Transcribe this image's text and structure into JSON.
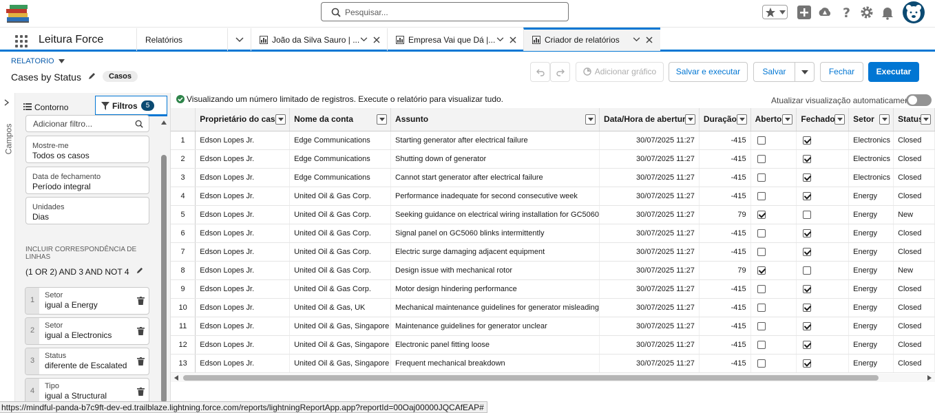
{
  "global": {
    "search_placeholder": "Pesquisar..."
  },
  "nav": {
    "app_name": "Leitura Force",
    "tabs": [
      {
        "label": "Relatórios"
      },
      {
        "label": "João da Silva Sauro | ..."
      },
      {
        "label": "Empresa Vai que Dá |..."
      },
      {
        "label": "Criador de relatórios"
      }
    ]
  },
  "header": {
    "report_label": "RELATORIO",
    "title": "Cases by Status",
    "type_pill": "Casos",
    "btn_add_chart": "Adicionar gráfico",
    "btn_save_run": "Salvar e executar",
    "btn_save": "Salvar",
    "btn_close": "Fechar",
    "btn_run": "Executar"
  },
  "rail": {
    "label": "Campos"
  },
  "panel": {
    "tab_outline": "Contorno",
    "tab_filters": "Filtros",
    "filter_count": "5",
    "add_filter_placeholder": "Adicionar filtro...",
    "standard_filters": [
      {
        "label": "Mostre-me",
        "value": "Todos os casos"
      },
      {
        "label": "Data de fechamento",
        "value": "Período integral"
      },
      {
        "label": "Unidades",
        "value": "Dias"
      }
    ],
    "logic_heading": "INCLUIR CORRESPONDÊNCIA DE LINHAS",
    "logic": "(1 OR 2) AND 3 AND NOT 4",
    "filters": [
      {
        "num": "1",
        "field": "Setor",
        "cond": "igual a Energy"
      },
      {
        "num": "2",
        "field": "Setor",
        "cond": "igual a Electronics"
      },
      {
        "num": "3",
        "field": "Status",
        "cond": "diferente de Escalated"
      },
      {
        "num": "4",
        "field": "Tipo",
        "cond": "igual a Structural"
      }
    ]
  },
  "main": {
    "notice": "Visualizando um número limitado de registros. Execute o relatório para visualizar tudo.",
    "auto_update": "Atualizar visualização automaticamente",
    "columns": [
      "Proprietário do caso",
      "Nome da conta",
      "Assunto",
      "Data/Hora de abertura",
      "Duração",
      "Aberto",
      "Fechado",
      "Setor",
      "Status"
    ],
    "rows": [
      {
        "n": "1",
        "owner": "Edson Lopes Jr.",
        "account": "Edge Communications",
        "subject": "Starting generator after electrical failure",
        "opened": "30/07/2025 11:27",
        "duration": "-415",
        "open": false,
        "closed": true,
        "sector": "Electronics",
        "status": "Closed"
      },
      {
        "n": "2",
        "owner": "Edson Lopes Jr.",
        "account": "Edge Communications",
        "subject": "Shutting down of generator",
        "opened": "30/07/2025 11:27",
        "duration": "-415",
        "open": false,
        "closed": true,
        "sector": "Electronics",
        "status": "Closed"
      },
      {
        "n": "3",
        "owner": "Edson Lopes Jr.",
        "account": "Edge Communications",
        "subject": "Cannot start generator after electrical failure",
        "opened": "30/07/2025 11:27",
        "duration": "-415",
        "open": false,
        "closed": true,
        "sector": "Electronics",
        "status": "Closed"
      },
      {
        "n": "4",
        "owner": "Edson Lopes Jr.",
        "account": "United Oil & Gas Corp.",
        "subject": "Performance inadequate for second consecutive week",
        "opened": "30/07/2025 11:27",
        "duration": "-415",
        "open": false,
        "closed": true,
        "sector": "Energy",
        "status": "Closed"
      },
      {
        "n": "5",
        "owner": "Edson Lopes Jr.",
        "account": "United Oil & Gas Corp.",
        "subject": "Seeking guidance on electrical wiring installation for GC5060",
        "opened": "30/07/2025 11:27",
        "duration": "79",
        "open": true,
        "closed": false,
        "sector": "Energy",
        "status": "New"
      },
      {
        "n": "6",
        "owner": "Edson Lopes Jr.",
        "account": "United Oil & Gas Corp.",
        "subject": "Signal panel on GC5060 blinks intermittently",
        "opened": "30/07/2025 11:27",
        "duration": "-415",
        "open": false,
        "closed": true,
        "sector": "Energy",
        "status": "Closed"
      },
      {
        "n": "7",
        "owner": "Edson Lopes Jr.",
        "account": "United Oil & Gas Corp.",
        "subject": "Electric surge damaging adjacent equipment",
        "opened": "30/07/2025 11:27",
        "duration": "-415",
        "open": false,
        "closed": true,
        "sector": "Energy",
        "status": "Closed"
      },
      {
        "n": "8",
        "owner": "Edson Lopes Jr.",
        "account": "United Oil & Gas Corp.",
        "subject": "Design issue with mechanical rotor",
        "opened": "30/07/2025 11:27",
        "duration": "79",
        "open": true,
        "closed": false,
        "sector": "Energy",
        "status": "New"
      },
      {
        "n": "9",
        "owner": "Edson Lopes Jr.",
        "account": "United Oil & Gas Corp.",
        "subject": "Motor design hindering performance",
        "opened": "30/07/2025 11:27",
        "duration": "-415",
        "open": false,
        "closed": true,
        "sector": "Energy",
        "status": "Closed"
      },
      {
        "n": "10",
        "owner": "Edson Lopes Jr.",
        "account": "United Oil & Gas, UK",
        "subject": "Mechanical maintenance guidelines for generator misleading",
        "opened": "30/07/2025 11:27",
        "duration": "-415",
        "open": false,
        "closed": true,
        "sector": "Energy",
        "status": "Closed"
      },
      {
        "n": "11",
        "owner": "Edson Lopes Jr.",
        "account": "United Oil & Gas, Singapore",
        "subject": "Maintenance guidelines for generator unclear",
        "opened": "30/07/2025 11:27",
        "duration": "-415",
        "open": false,
        "closed": true,
        "sector": "Energy",
        "status": "Closed"
      },
      {
        "n": "12",
        "owner": "Edson Lopes Jr.",
        "account": "United Oil & Gas, Singapore",
        "subject": "Electronic panel fitting loose",
        "opened": "30/07/2025 11:27",
        "duration": "-415",
        "open": false,
        "closed": true,
        "sector": "Energy",
        "status": "Closed"
      },
      {
        "n": "13",
        "owner": "Edson Lopes Jr.",
        "account": "United Oil & Gas, Singapore",
        "subject": "Frequent mechanical breakdown",
        "opened": "30/07/2025 11:27",
        "duration": "-415",
        "open": false,
        "closed": true,
        "sector": "Energy",
        "status": "Closed"
      }
    ]
  },
  "statusbar": {
    "url": "https://mindful-panda-b7c9ft-dev-ed.trailblaze.lightning.force.com/reports/lightningReportApp.app?reportId=00Oaj00000JQCAfEAP#"
  },
  "colors": {
    "brand": "#0176d3",
    "success": "#2e844a"
  }
}
